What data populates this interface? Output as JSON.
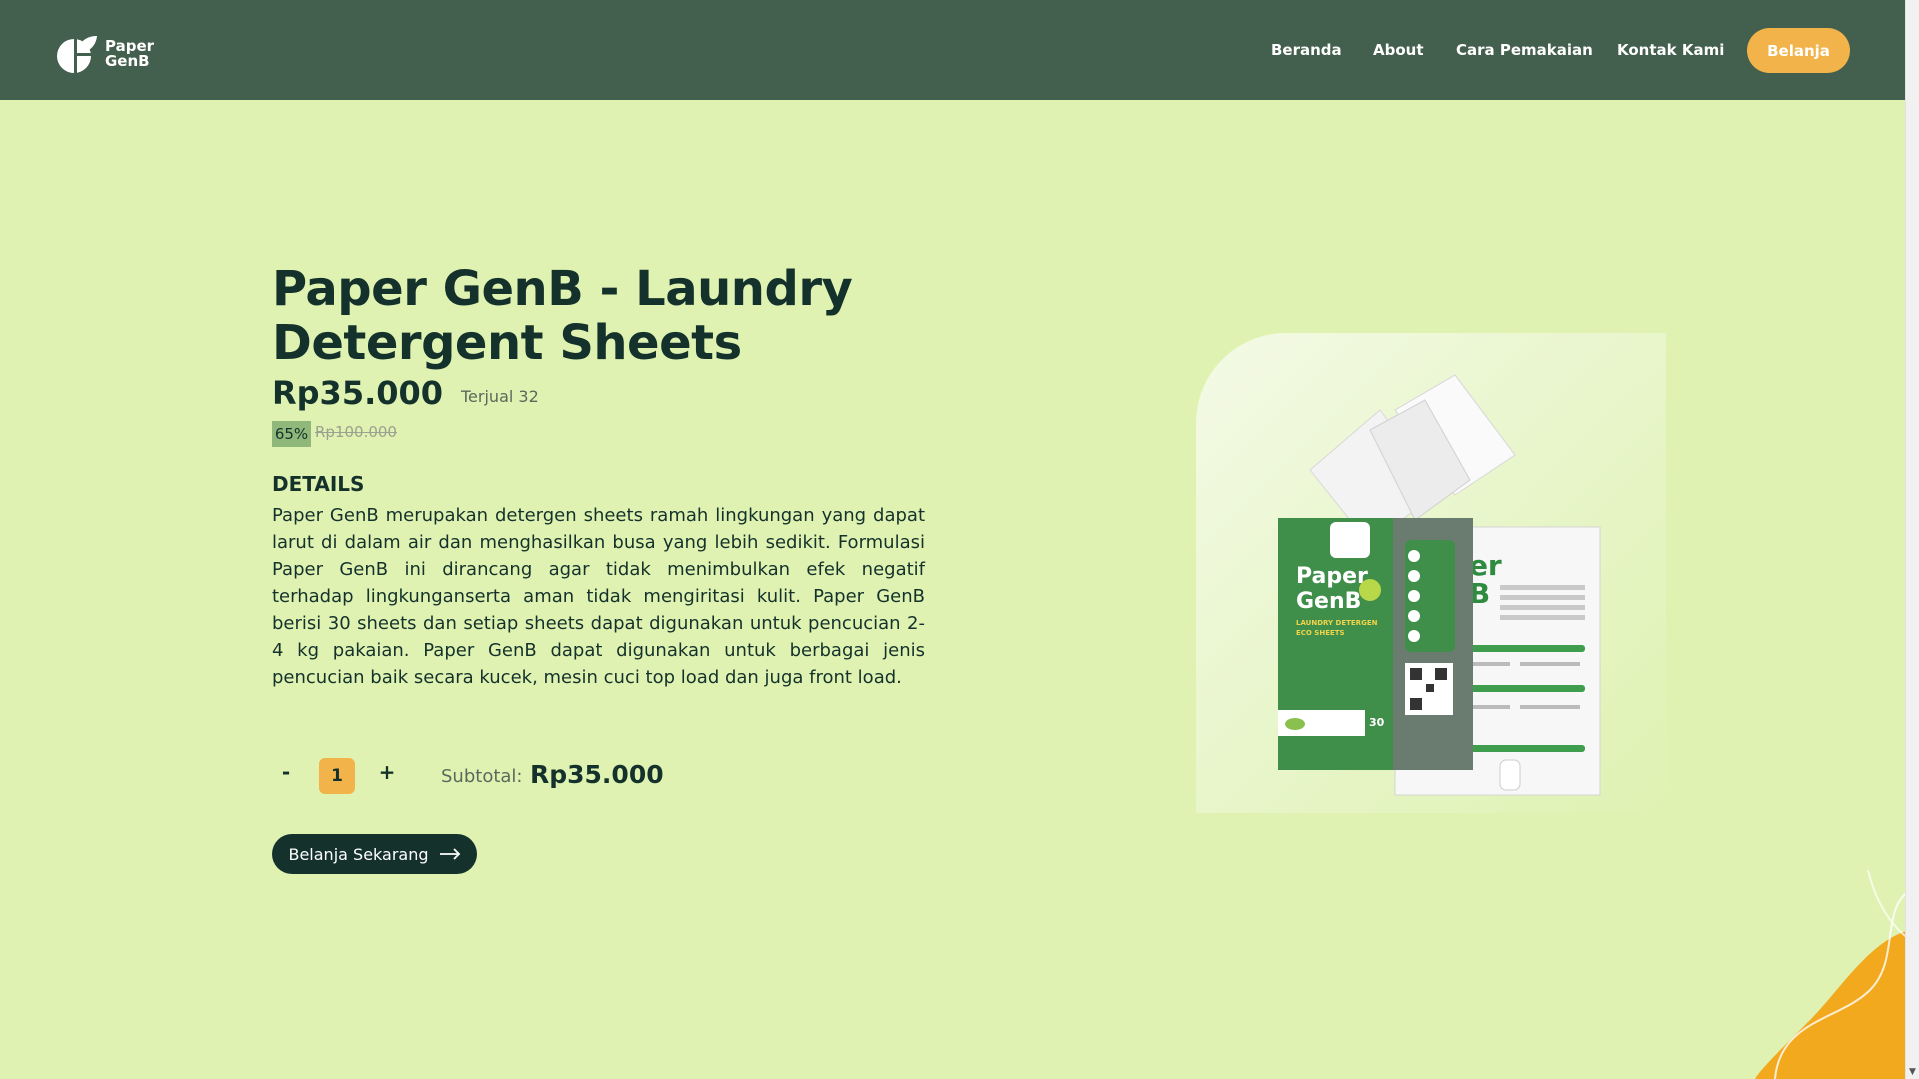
{
  "brand": {
    "line1": "Paper",
    "line2": "GenB"
  },
  "nav": {
    "items": [
      "Beranda",
      "About",
      "Cara Pemakaian",
      "Kontak Kami"
    ],
    "shop_label": "Belanja"
  },
  "product": {
    "title": "Paper GenB - Laundry Detergent Sheets",
    "price": "Rp35.000",
    "sold": "Terjual 32",
    "discount": "65%",
    "old_price": "Rp100.000",
    "details_heading": "DETAILS",
    "details_text": "Paper GenB merupakan detergen sheets ramah lingkungan yang dapat larut di dalam air dan menghasilkan busa yang lebih sedikit. Formulasi Paper GenB ini dirancang agar tidak menimbulkan efek negatif terhadap lingkunganserta aman tidak mengiritasi kulit. Paper GenB berisi 30 sheets dan setiap sheets dapat digunakan untuk pencucian 2-4 kg pakaian. Paper GenB dapat digunakan untuk berbagai jenis pencucian baik secara kucek, mesin cuci top load dan juga front load."
  },
  "cart": {
    "minus": "-",
    "plus": "+",
    "quantity": "1",
    "subtotal_label": "Subtotal:",
    "subtotal_value": "Rp35.000",
    "buy_label": "Belanja Sekarang"
  },
  "packaging": {
    "brand": "Paper GenB",
    "subtitle": "LAUNDRY DETERGEN ECO SHEETS",
    "count": "30",
    "count_unit": "SHEETS"
  },
  "colors": {
    "nav_bg": "#435f4d",
    "page_bg": "#dff2b2",
    "accent": "#f2b44a",
    "dark": "#14322b"
  }
}
